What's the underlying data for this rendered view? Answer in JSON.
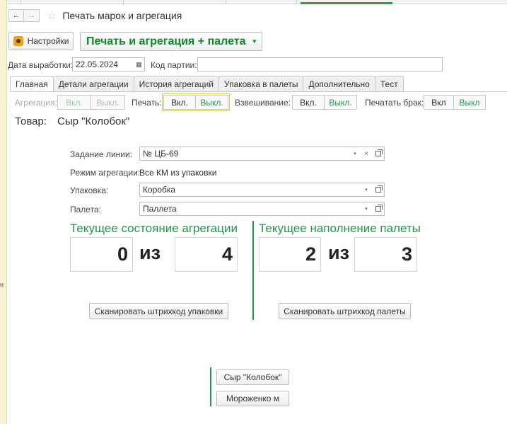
{
  "window": {
    "title": "Печать марок и агрегация",
    "side_mark": "н"
  },
  "toolbar": {
    "settings_label": "Настройки",
    "main_button_label": "Печать и агрегация + палета"
  },
  "header_fields": {
    "date_label": "Дата выработки:",
    "date_value": "22.05.2024",
    "batch_label": "Код партии:",
    "batch_value": ""
  },
  "tabs": [
    "Главная",
    "Детали агрегации",
    "История агрегаций",
    "Упаковка в палеты",
    "Дополнительно",
    "Тест"
  ],
  "toggles": {
    "aggregation_label": "Агрегация:",
    "aggregation_on": "Вкл.",
    "aggregation_off": "Выкл.",
    "print_label": "Печать:",
    "print_on": "Вкл.",
    "print_off": "Выкл.",
    "weigh_label": "Взвешивание:",
    "weigh_on": "Вкл.",
    "weigh_off": "Выкл.",
    "defect_label": "Печатать брак:",
    "defect_on": "Вкл",
    "defect_off": "Выкл"
  },
  "product": {
    "label": "Товар:",
    "value": "Сыр \"Колобок\""
  },
  "form": {
    "line_task_label": "Задание линии:",
    "line_task_value": "№ ЦБ-69",
    "agg_mode_label": "Режим агрегации:",
    "agg_mode_value": "Все КМ из упаковки",
    "package_label": "Упаковка:",
    "package_value": "Коробка",
    "pallet_label": "Палета:",
    "pallet_value": "Паллета"
  },
  "aggregation_state": {
    "title": "Текущее состояние агрегации",
    "current": "0",
    "of": "из",
    "total": "4",
    "scan_button": "Сканировать штрихкод упаковки"
  },
  "pallet_state": {
    "title": "Текущее наполнение палеты",
    "current": "2",
    "of": "из",
    "total": "3",
    "scan_button": "Сканировать штрихкод палеты"
  },
  "product_buttons": [
    "Сыр \"Колобок\"",
    "Мороженко м"
  ],
  "icons": {
    "back": "←",
    "forward": "→",
    "star": "☆",
    "dropdown": "▾",
    "clear": "×",
    "calendar": "▦"
  },
  "colors": {
    "accent_green": "#1f9a4a",
    "main_button_text": "#0a8a28",
    "focus_border": "#e8c15c"
  }
}
